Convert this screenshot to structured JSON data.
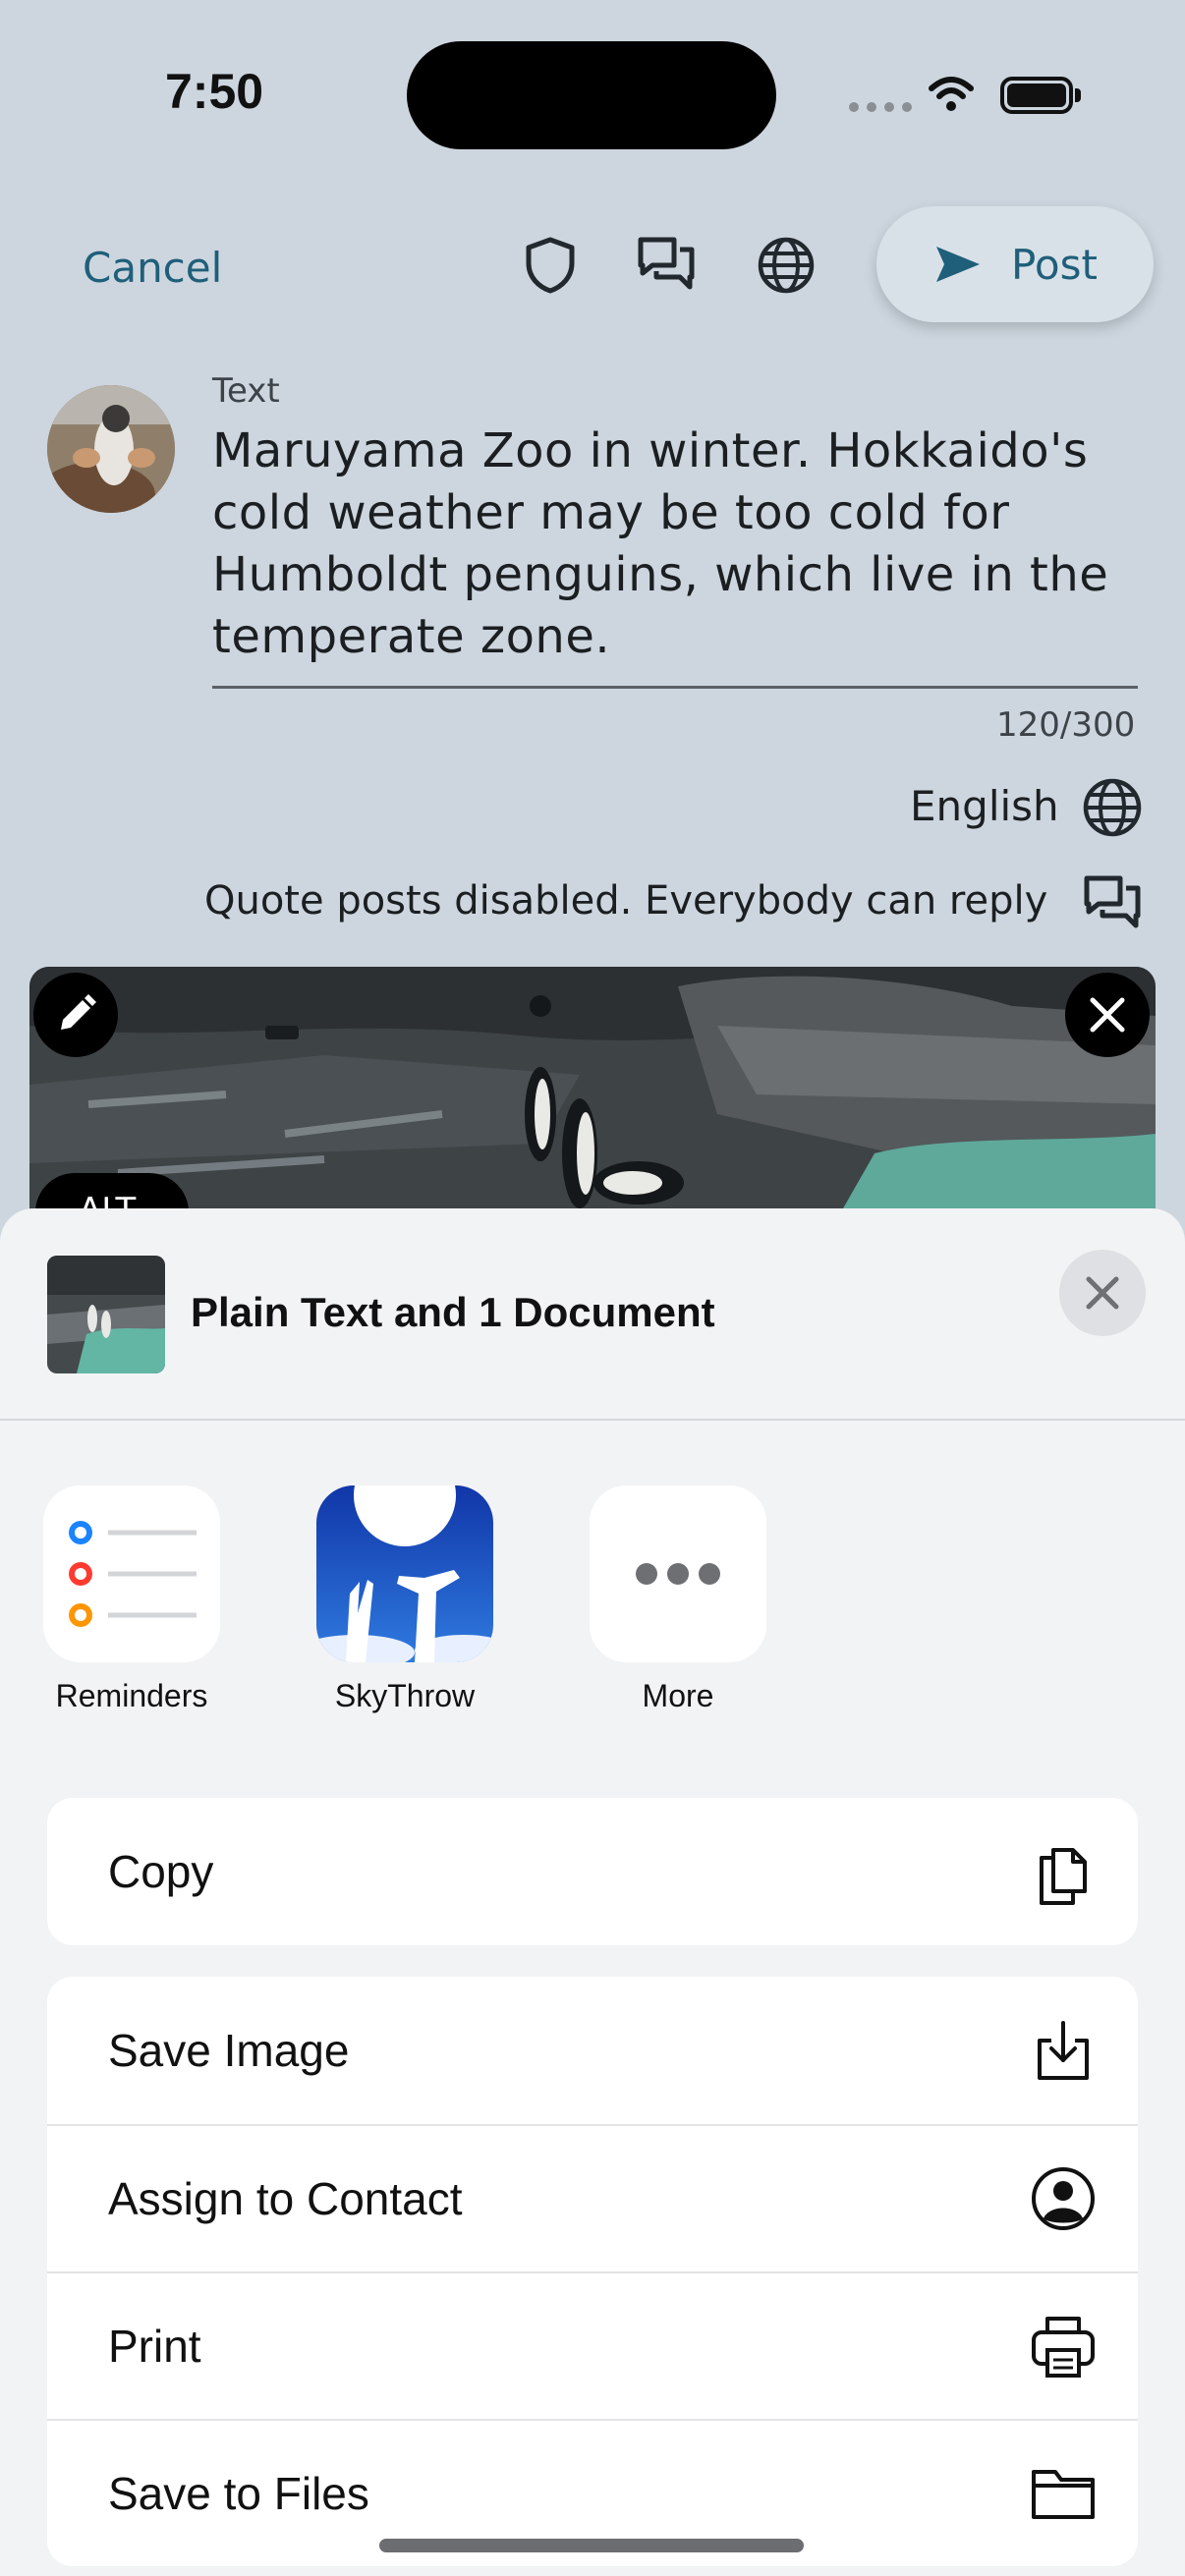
{
  "status_bar": {
    "time": "7:50"
  },
  "compose": {
    "cancel_label": "Cancel",
    "post_label": "Post",
    "field_label": "Text",
    "text": "Maruyama Zoo in winter. Hokkaido's cold weather may be too cold for Humboldt penguins, which live in the temperate zone.",
    "counter": "120/300",
    "language": "English",
    "quote_setting": "Quote posts disabled. Everybody can reply",
    "alt_chip": "ALT"
  },
  "share_sheet": {
    "title": "Plain Text and 1 Document",
    "apps": [
      {
        "label": "Reminders",
        "icon": "reminders-icon"
      },
      {
        "label": "SkyThrow",
        "icon": "skythrow-icon"
      },
      {
        "label": "More",
        "icon": "more-icon"
      }
    ],
    "group1": [
      {
        "label": "Copy",
        "icon": "copy-icon"
      }
    ],
    "group2": [
      {
        "label": "Save Image",
        "icon": "save-image-icon"
      },
      {
        "label": "Assign to Contact",
        "icon": "contact-icon"
      },
      {
        "label": "Print",
        "icon": "print-icon"
      },
      {
        "label": "Save to Files",
        "icon": "folder-icon"
      }
    ]
  },
  "colors": {
    "accent": "#1f5f7a",
    "background": "#cdd6df",
    "sheet": "#f2f3f5"
  }
}
